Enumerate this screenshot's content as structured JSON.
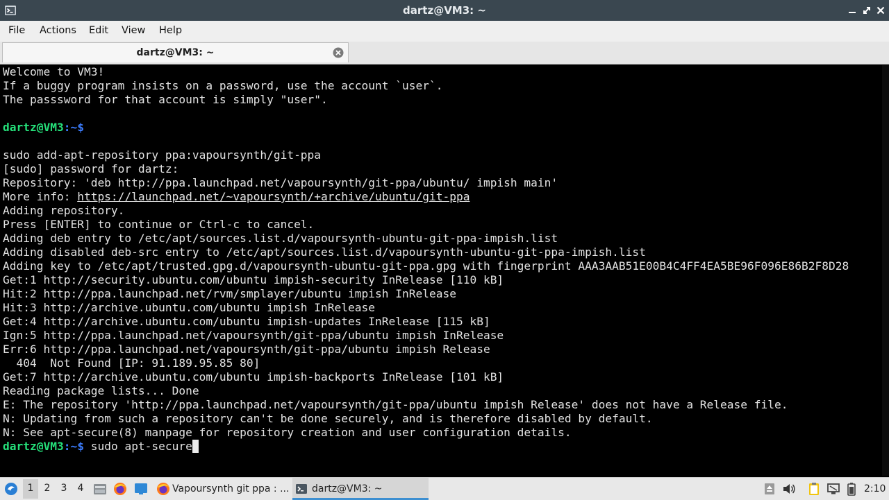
{
  "window": {
    "title": "dartz@VM3: ~",
    "controls": [
      "minimize-icon",
      "restore-icon",
      "close-icon"
    ]
  },
  "menu": {
    "items": [
      "File",
      "Actions",
      "Edit",
      "View",
      "Help"
    ]
  },
  "tab": {
    "label": "dartz@VM3: ~"
  },
  "terminal": {
    "prompt_user": "dartz@VM3",
    "prompt_path": ":~$",
    "lines": [
      "Welcome to VM3!",
      "If a buggy program insists on a password, use the account `user`.",
      "The passsword for that account is simply \"user\".",
      "",
      "",
      "",
      "sudo add-apt-repository ppa:vapoursynth/git-ppa",
      "[sudo] password for dartz:",
      "Repository: 'deb http://ppa.launchpad.net/vapoursynth/git-ppa/ubuntu/ impish main'",
      "More info: ",
      "Adding repository.",
      "Press [ENTER] to continue or Ctrl-c to cancel.",
      "Adding deb entry to /etc/apt/sources.list.d/vapoursynth-ubuntu-git-ppa-impish.list",
      "Adding disabled deb-src entry to /etc/apt/sources.list.d/vapoursynth-ubuntu-git-ppa-impish.list",
      "Adding key to /etc/apt/trusted.gpg.d/vapoursynth-ubuntu-git-ppa.gpg with fingerprint AAA3AAB51E00B4C4FF4EA5BE96F096E86B2F8D28",
      "Get:1 http://security.ubuntu.com/ubuntu impish-security InRelease [110 kB]",
      "Hit:2 http://ppa.launchpad.net/rvm/smplayer/ubuntu impish InRelease",
      "Hit:3 http://archive.ubuntu.com/ubuntu impish InRelease",
      "Get:4 http://archive.ubuntu.com/ubuntu impish-updates InRelease [115 kB]",
      "Ign:5 http://ppa.launchpad.net/vapoursynth/git-ppa/ubuntu impish InRelease",
      "Err:6 http://ppa.launchpad.net/vapoursynth/git-ppa/ubuntu impish Release",
      "  404  Not Found [IP: 91.189.95.85 80]",
      "Get:7 http://archive.ubuntu.com/ubuntu impish-backports InRelease [101 kB]",
      "Reading package lists... Done",
      "E: The repository 'http://ppa.launchpad.net/vapoursynth/git-ppa/ubuntu impish Release' does not have a Release file.",
      "N: Updating from such a repository can't be done securely, and is therefore disabled by default.",
      "N: See apt-secure(8) manpage for repository creation and user configuration details.",
      ""
    ],
    "more_info_link": "https://launchpad.net/~vapoursynth/+archive/ubuntu/git-ppa",
    "current_command": " sudo apt-secure"
  },
  "taskbar": {
    "workspaces": [
      "1",
      "2",
      "3",
      "4"
    ],
    "active_workspace": "1",
    "tasks": [
      {
        "label": "Vapoursynth git ppa : ...",
        "icon": "firefox-icon"
      },
      {
        "label": "dartz@VM3: ~",
        "icon": "terminal-icon"
      }
    ],
    "tray_icons": [
      "storage-icon",
      "volume-icon",
      "clipboard-icon",
      "network-icon",
      "battery-icon"
    ],
    "clock": "2:10"
  },
  "colors": {
    "titlebar": "#3a4750",
    "prompt_user": "#25e07a",
    "prompt_path": "#3c7dff",
    "terminal_bg": "#000000",
    "terminal_fg": "#e2e2e2"
  }
}
